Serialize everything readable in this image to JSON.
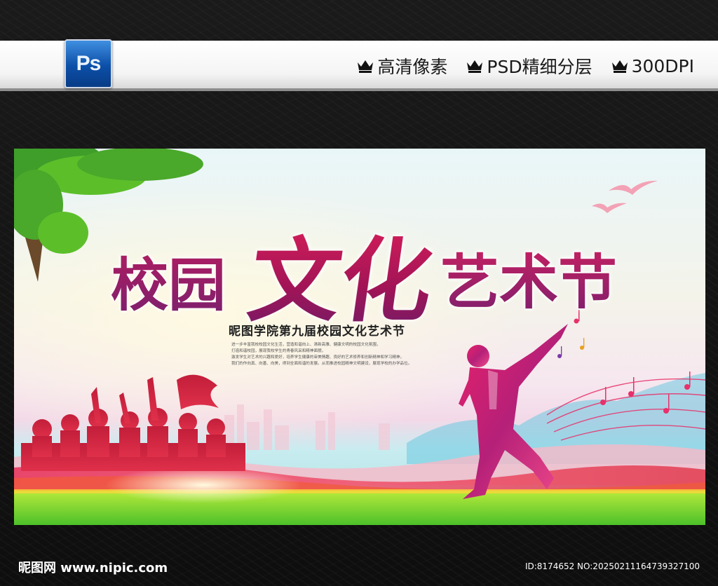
{
  "header": {
    "app_icon_label": "Ps",
    "badges": [
      {
        "icon": "crown-icon",
        "label": "高清像素"
      },
      {
        "icon": "crown-icon",
        "label": "PSD精细分层"
      },
      {
        "icon": "crown-icon",
        "label": "300DPI"
      }
    ]
  },
  "poster": {
    "title_part1": "校园",
    "title_part2": "文化",
    "title_part3": "艺术节",
    "subtitle": "昵图学院第九届校园文化艺术节",
    "body_lines": [
      "进一步丰富我校校园文化生活，营造和谐向上、清新高雅、健康文明的校园文化氛围，",
      "打造和谐校园，展现我校学生的青春风采和精神面貌，",
      "激发学生对艺术的兴趣和爱好，培养学生健康的审美情趣、良好的艺术修养和创新精神和学习精神，",
      "我们的作向真、向善、向美，得到全面和谐的发展。从而推进校园精神文明建设，展现学校的办学品位。"
    ],
    "colors": {
      "title_primary": "#b51e5f",
      "title_secondary": "#7a1f6e",
      "tree": "#3f9e2a",
      "grass": "#6fcf2a"
    }
  },
  "footer": {
    "site_logo": "昵图网 www.nipic.com",
    "image_id": "ID:8174652 NO:20250211164739327100"
  }
}
